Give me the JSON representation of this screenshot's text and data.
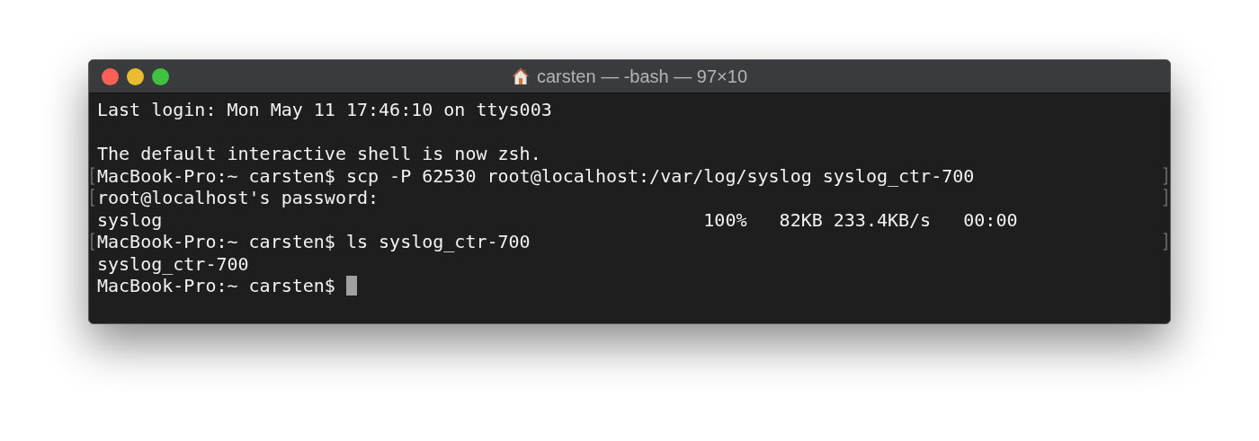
{
  "window": {
    "title": "carsten — -bash — 97×10"
  },
  "lines": [
    {
      "text": "Last login: Mon May 11 17:46:10 on ttys003",
      "marked": false,
      "cursor": false
    },
    {
      "marked": false,
      "cursor": false
    },
    {
      "text": "The default interactive shell is now zsh.",
      "marked": false,
      "cursor": false
    },
    {
      "text": "MacBook-Pro:~ carsten$ scp -P 62530 root@localhost:/var/log/syslog syslog_ctr-700",
      "marked": true,
      "cursor": false
    },
    {
      "text": "root@localhost's password:",
      "marked": true,
      "cursor": false
    },
    {
      "text": "syslog                                                  100%   82KB 233.4KB/s   00:00",
      "marked": false,
      "cursor": false
    },
    {
      "text": "MacBook-Pro:~ carsten$ ls syslog_ctr-700",
      "marked": true,
      "cursor": false
    },
    {
      "text": "syslog_ctr-700",
      "marked": false,
      "cursor": false
    },
    {
      "text": "MacBook-Pro:~ carsten$ ",
      "marked": false,
      "cursor": true
    }
  ]
}
